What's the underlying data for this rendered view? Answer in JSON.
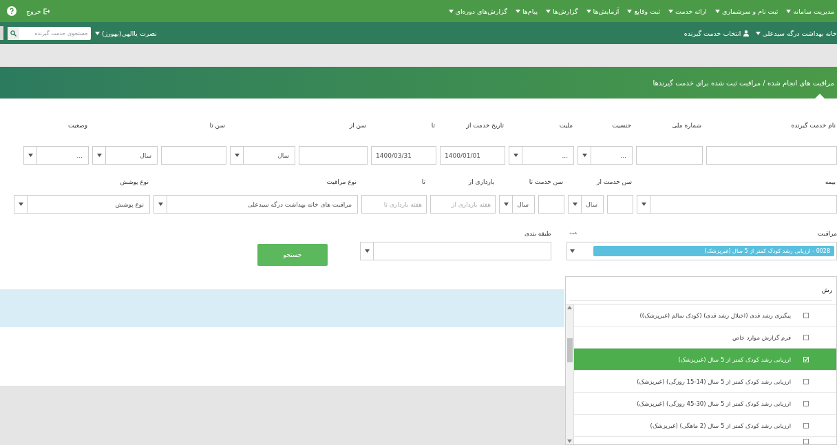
{
  "navbar": {
    "menu": [
      {
        "label": "مدیریت سامانه"
      },
      {
        "label": "ثبت نام و سرشماری"
      },
      {
        "label": "ارائه خدمت"
      },
      {
        "label": "ثبت وقایع"
      },
      {
        "label": "آزمایش‌ها"
      },
      {
        "label": "گزارش‌ها"
      },
      {
        "label": "پیام‌ها"
      },
      {
        "label": "گزارش‌های دوره‌ای"
      }
    ],
    "logout": "خروج"
  },
  "subbar": {
    "facility": "خانه بهداشت درگه سیدعلی",
    "select_client": "انتخاب خدمت گیرنده",
    "search": {
      "placeholder": "جستجوی خدمت گیرنده"
    },
    "user": "نصرت یاالهی(بهورز)"
  },
  "page_title": "مراقبت های انجام شده / مراقبت ثبت شده برای خدمت گیرندها",
  "form": {
    "first_line": [
      {
        "label": "نام خدمت گیرنده",
        "controls": [
          {
            "kind": "input"
          }
        ]
      },
      {
        "label": "شماره ملی",
        "controls": [
          {
            "kind": "input"
          }
        ]
      },
      {
        "label": "جنسیت",
        "controls": [
          {
            "kind": "select",
            "value": "..."
          }
        ]
      },
      {
        "label": "ملیت",
        "controls": [
          {
            "kind": "select",
            "value": "..."
          }
        ]
      },
      {
        "label": "تاریخ خدمت از",
        "controls": [
          {
            "kind": "input",
            "value": "1400/01/01"
          }
        ]
      },
      {
        "label": "تا",
        "controls": [
          {
            "kind": "input",
            "value": "1400/03/31"
          }
        ]
      },
      {
        "label": "سن از",
        "controls": [
          {
            "kind": "input"
          },
          {
            "kind": "select",
            "value": "سال"
          }
        ]
      },
      {
        "label": "سن تا",
        "controls": [
          {
            "kind": "input"
          },
          {
            "kind": "select",
            "value": "سال"
          }
        ]
      },
      {
        "label": "وضعیت",
        "controls": [
          {
            "kind": "select",
            "value": "..."
          }
        ]
      }
    ],
    "second_line": [
      {
        "label": "بیمه",
        "controls": [
          {
            "kind": "select"
          }
        ]
      },
      {
        "label": "سن خدمت از",
        "controls": [
          {
            "kind": "input"
          },
          {
            "kind": "select",
            "value": "سال"
          }
        ]
      },
      {
        "label": "سن خدمت تا",
        "controls": [
          {
            "kind": "input"
          },
          {
            "kind": "select",
            "value": "سال"
          }
        ]
      },
      {
        "label": "بارداری از",
        "controls": [
          {
            "kind": "input",
            "placeholder": "هفته بارداری از"
          }
        ]
      },
      {
        "label": "تا",
        "controls": [
          {
            "kind": "input",
            "placeholder": "هفته بارداری تا"
          }
        ]
      },
      {
        "label": "نوع مراقبت",
        "controls": [
          {
            "kind": "select",
            "value": "مراقبت های خانه بهداشت درگه سیدعلی"
          }
        ]
      },
      {
        "label": "نوع پوشش",
        "controls": [
          {
            "kind": "select",
            "value": "نوع پوشش"
          }
        ]
      }
    ],
    "care": {
      "label": "مراقبت",
      "select_all": "همه",
      "tag": "0028 - ارزیابی رشد کودک کمتر از 5 سال (غیرپزشک)"
    },
    "classification": {
      "label": "طبقه بندی"
    },
    "search_button": "جستجو"
  },
  "care_dropdown": {
    "search_value": "رش",
    "items": [
      {
        "label": "پیگیری رشد قدی (اختلال رشد قدی) (کودک سالم (غیرپزشک))",
        "checked": false,
        "selected": false
      },
      {
        "label": "فرم گزارش موارد خاص",
        "checked": false,
        "selected": false
      },
      {
        "label": "ارزیابی رشد کودک کمتر از 5 سال (غیرپزشک)",
        "checked": true,
        "selected": true
      },
      {
        "label": "ارزیابی رشد کودک کمتر از 5 سال (14-15 روزگی) (غیرپزشک)",
        "checked": false,
        "selected": false
      },
      {
        "label": "ارزیابی رشد کودک کمتر از 5 سال (30-45 روزگی) (غیرپزشک)",
        "checked": false,
        "selected": false
      },
      {
        "label": "ارزیابی رشد کودک کمتر از 5 سال (2 ماهگی) (غیرپزشک)",
        "checked": false,
        "selected": false
      }
    ],
    "partial_item": {
      "checked": false
    }
  }
}
